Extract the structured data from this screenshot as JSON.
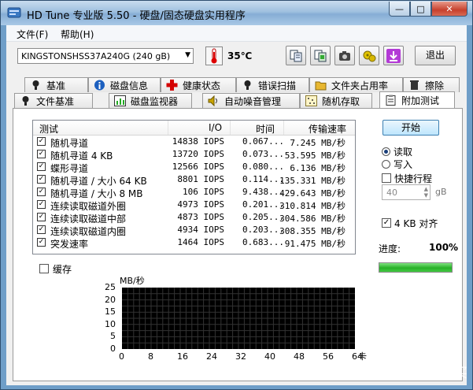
{
  "window": {
    "title": "HD Tune 专业版 5.50 - 硬盘/固态硬盘实用程序",
    "controls": {
      "minimize": "—",
      "maximize": "□",
      "close": "✕"
    }
  },
  "menu": {
    "file": "文件(F)",
    "help": "帮助(H)"
  },
  "toolbar": {
    "drive": "KINGSTONSHSS37A240G (240 gB)",
    "temperature": "35℃",
    "exit": "退出",
    "icons": [
      "copy-info-icon",
      "copy-screen-icon",
      "camera-icon",
      "options-icon",
      "download-icon"
    ]
  },
  "tabs": {
    "row1": [
      {
        "label": "基准",
        "icon": "bulb-icon"
      },
      {
        "label": "磁盘信息",
        "icon": "info-icon"
      },
      {
        "label": "健康状态",
        "icon": "health-cross-icon"
      },
      {
        "label": "错误扫描",
        "icon": "bulb-icon"
      },
      {
        "label": "文件夹占用率",
        "icon": "folder-icon"
      },
      {
        "label": "擦除",
        "icon": "trash-icon"
      }
    ],
    "row2": [
      {
        "label": "文件基准",
        "icon": "bulb-icon"
      },
      {
        "label": "磁盘监视器",
        "icon": "monitor-chart-icon"
      },
      {
        "label": "自动噪音管理",
        "icon": "speaker-icon"
      },
      {
        "label": "随机存取",
        "icon": "random-dots-icon"
      },
      {
        "label": "附加测试",
        "icon": "clipboard-icon"
      }
    ],
    "active": "附加测试"
  },
  "results": {
    "headers": [
      "测试",
      "I/O",
      "时间",
      "传输速率"
    ],
    "rows": [
      {
        "name": "随机寻道",
        "io": "14838 IOPS",
        "time": "0.067...",
        "rate": "7.245 MB/秒"
      },
      {
        "name": "随机寻道 4 KB",
        "io": "13720 IOPS",
        "time": "0.073...",
        "rate": "53.595 MB/秒"
      },
      {
        "name": "蝶形寻道",
        "io": "12566 IOPS",
        "time": "0.080...",
        "rate": "6.136 MB/秒"
      },
      {
        "name": "随机寻道 / 大小 64 KB",
        "io": "8801 IOPS",
        "time": "0.114...",
        "rate": "135.331 MB/秒"
      },
      {
        "name": "随机寻道 / 大小 8 MB",
        "io": "106 IOPS",
        "time": "9.438...",
        "rate": "429.643 MB/秒"
      },
      {
        "name": "连续读取磁道外圈",
        "io": "4973 IOPS",
        "time": "0.201...",
        "rate": "310.814 MB/秒"
      },
      {
        "name": "连续读取磁道中部",
        "io": "4873 IOPS",
        "time": "0.205...",
        "rate": "304.586 MB/秒"
      },
      {
        "name": "连续读取磁道内圈",
        "io": "4934 IOPS",
        "time": "0.203...",
        "rate": "308.355 MB/秒"
      },
      {
        "name": "突发速率",
        "io": "1464 IOPS",
        "time": "0.683...",
        "rate": "91.475 MB/秒"
      }
    ]
  },
  "controls": {
    "start": "开始",
    "read": "读取",
    "write": "写入",
    "mode_selected": "read",
    "quick_stroke": "快捷行程",
    "quick_stroke_checked": false,
    "stroke_value": "40",
    "stroke_unit": "gB",
    "align_4kb": "4 KB 对齐",
    "align_checked": true,
    "progress_label": "进度:",
    "progress_value": "100%",
    "progress_fraction": 1.0,
    "cache": "缓存",
    "cache_checked": false
  },
  "chart_data": {
    "type": "line",
    "ylabel": "MB/秒",
    "xlabel": "卡",
    "y_ticks": [
      "25",
      "20",
      "15",
      "10",
      "5",
      "0"
    ],
    "x_ticks": [
      "0",
      "8",
      "16",
      "24",
      "32",
      "40",
      "48",
      "56",
      "64"
    ],
    "ylim": [
      0,
      25
    ],
    "xlim": [
      0,
      64
    ],
    "series": [],
    "grid": true,
    "background": "#000000"
  },
  "watermark": "值 什么值得买"
}
